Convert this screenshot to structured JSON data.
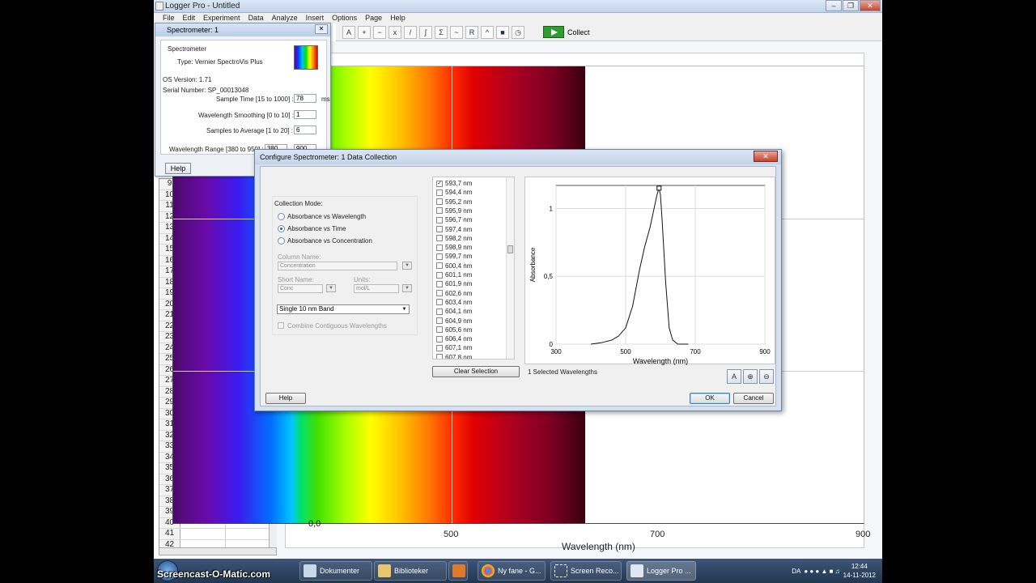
{
  "window": {
    "title": "Logger Pro - Untitled",
    "menu": [
      "File",
      "Edit",
      "Experiment",
      "Data",
      "Analyze",
      "Insert",
      "Options",
      "Page",
      "Help"
    ],
    "collect_label": "Collect"
  },
  "table": {
    "row_numbers": [
      "9",
      "10",
      "11",
      "12",
      "13",
      "14",
      "15",
      "16",
      "17",
      "18",
      "19",
      "20",
      "21",
      "22",
      "23",
      "24",
      "25",
      "26",
      "27",
      "28",
      "29",
      "30",
      "31",
      "32",
      "33",
      "34",
      "35",
      "36",
      "37",
      "38",
      "39",
      "40",
      "41",
      "42"
    ]
  },
  "main_graph": {
    "x_ticks": [
      "500",
      "700",
      "900"
    ],
    "y_tick": "0,0",
    "xlabel": "Wavelength (nm)"
  },
  "spectrometer_window": {
    "title": "Spectrometer: 1",
    "heading": "Spectrometer",
    "type": "Type: Vernier SpectroVis Plus",
    "os_version": "OS Version: 1.71",
    "serial": "Serial Number: SP_00013048",
    "sample_time_label": "Sample Time [15 to 1000] :",
    "sample_time_value": "78",
    "sample_time_unit": "ms",
    "smoothing_label": "Wavelength Smoothing [0 to 10] :",
    "smoothing_value": "1",
    "average_label": "Samples to Average [1 to 20] :",
    "average_value": "6",
    "range_label": "Wavelength Range [380 to 950] :",
    "range_value_a": "380",
    "range_value_b": "900",
    "help_label": "Help"
  },
  "dialog": {
    "title": "Configure Spectrometer: 1 Data Collection",
    "collection_mode_label": "Collection Mode:",
    "modes": [
      "Absorbance vs Wavelength",
      "Absorbance vs Time",
      "Absorbance vs Concentration"
    ],
    "selected_mode": "Absorbance vs Time",
    "column_name_label": "Column Name:",
    "column_name_value": "Concentration",
    "short_name_label": "Short Name:",
    "short_name_value": "Conc",
    "units_label": "Units:",
    "units_value": "mol/L",
    "band_select": "Single 10 nm Band",
    "combine_label": "Combine Contiguous Wavelengths",
    "wavelengths": [
      {
        "label": "593,7 nm",
        "checked": true
      },
      {
        "label": "594,4 nm",
        "checked": false
      },
      {
        "label": "595,2 nm",
        "checked": false
      },
      {
        "label": "595,9 nm",
        "checked": false
      },
      {
        "label": "596,7 nm",
        "checked": false
      },
      {
        "label": "597,4 nm",
        "checked": false
      },
      {
        "label": "598,2 nm",
        "checked": false
      },
      {
        "label": "598,9 nm",
        "checked": false
      },
      {
        "label": "599,7 nm",
        "checked": false
      },
      {
        "label": "600,4 nm",
        "checked": false
      },
      {
        "label": "601,1 nm",
        "checked": false
      },
      {
        "label": "601,9 nm",
        "checked": false
      },
      {
        "label": "602,6 nm",
        "checked": false
      },
      {
        "label": "603,4 nm",
        "checked": false
      },
      {
        "label": "604,1 nm",
        "checked": false
      },
      {
        "label": "604,9 nm",
        "checked": false
      },
      {
        "label": "605,6 nm",
        "checked": false
      },
      {
        "label": "606,4 nm",
        "checked": false
      },
      {
        "label": "607,1 nm",
        "checked": false
      },
      {
        "label": "607,8 nm",
        "checked": false
      }
    ],
    "clear_selection_label": "Clear Selection",
    "selected_count_text": "1 Selected Wavelengths",
    "help_label": "Help",
    "ok_label": "OK",
    "cancel_label": "Cancel"
  },
  "chart_data": {
    "type": "line",
    "title": "",
    "xlabel": "Wavelength (nm)",
    "ylabel": "Absorbance",
    "xlim": [
      300,
      900
    ],
    "ylim": [
      0,
      1.17
    ],
    "x_ticks": [
      "300",
      "500",
      "700",
      "900"
    ],
    "y_ticks": [
      "0",
      "0,5",
      "1"
    ],
    "grid": true,
    "series": [
      {
        "x": [
          400,
          430,
          460,
          480,
          500,
          520,
          540,
          555,
          570,
          580,
          590,
          596,
          600,
          605,
          615,
          625,
          635,
          650,
          680
        ],
        "values": [
          0.0,
          0.01,
          0.03,
          0.06,
          0.12,
          0.28,
          0.55,
          0.72,
          0.86,
          0.98,
          1.1,
          1.15,
          1.1,
          0.9,
          0.45,
          0.12,
          0.03,
          0.0,
          0.0
        ]
      }
    ],
    "marker": {
      "x": 596,
      "y": 1.15
    }
  },
  "taskbar": {
    "items": [
      "Dokumenter",
      "Biblioteker",
      "Ny fane - G...",
      "Screen Reco...",
      "Logger Pro ..."
    ],
    "lang": "DA",
    "time": "12:44",
    "date": "14-11-2012",
    "watermark": "Screencast-O-Matic.com"
  },
  "colors": {
    "accent": "#1f5aa8",
    "collect_green": "#2f9c2f",
    "close_red": "#c7432e"
  }
}
